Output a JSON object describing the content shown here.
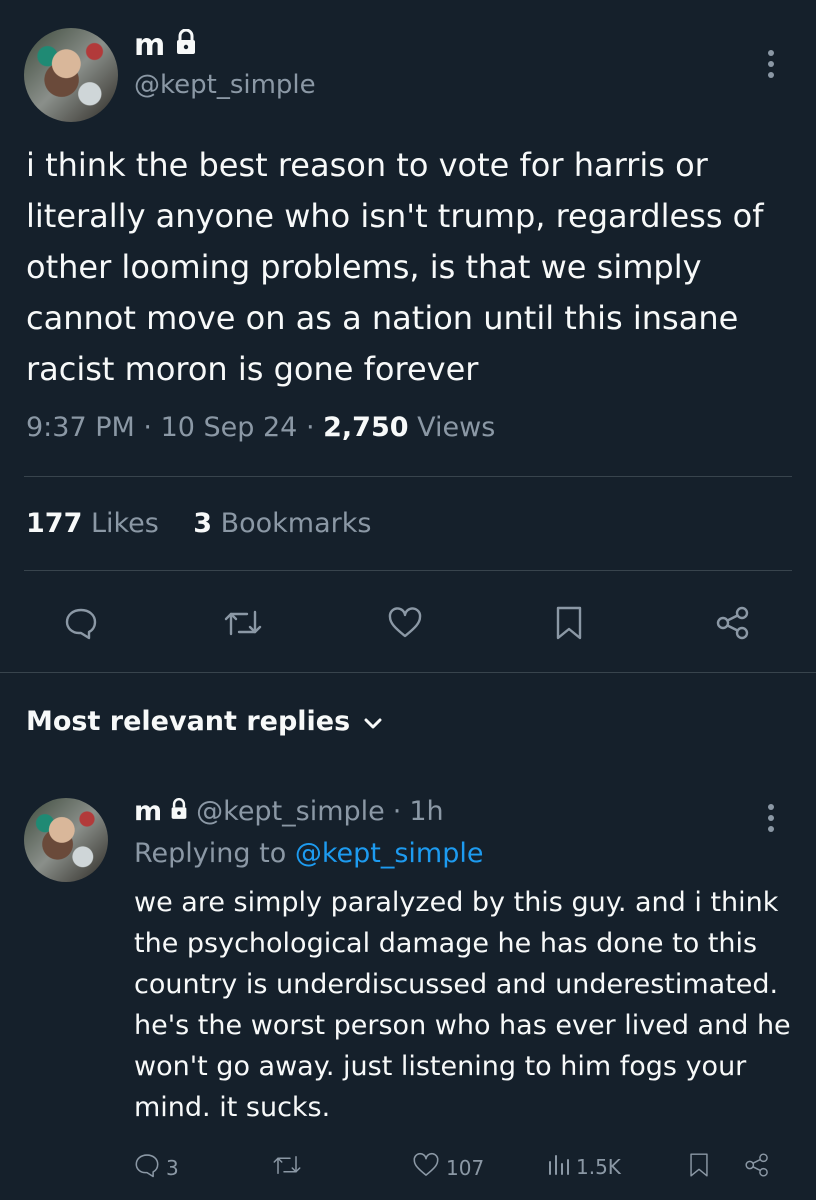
{
  "tweet": {
    "author_name": "m",
    "author_handle": "@kept_simple",
    "text": "i think the best reason to vote for harris or literally anyone who isn't trump, regardless of other looming problems, is that we simply cannot move on as a nation until this insane racist moron is gone forever",
    "time": "9:37 PM",
    "date": "10 Sep 24",
    "views_count": "2,750",
    "views_label": "Views",
    "separator": "·",
    "likes_count": "177",
    "likes_label": "Likes",
    "bookmarks_count": "3",
    "bookmarks_label": "Bookmarks"
  },
  "replies_section": {
    "header": "Most relevant replies"
  },
  "reply": {
    "author_name": "m",
    "author_handle": "@kept_simple",
    "age": "1h",
    "replying_prefix": "Replying to",
    "replying_to": "@kept_simple",
    "text": "we are simply paralyzed by this guy. and i think the psychological damage he has done to this country is underdiscussed and underestimated. he's the worst person who has ever lived and he won't go away. just listening to him fogs your mind. it sucks.",
    "reply_count": "3",
    "like_count": "107",
    "view_count": "1.5K"
  },
  "icons": {
    "lock": "lock-icon",
    "more": "more-vertical-icon",
    "reply": "reply-icon",
    "retweet": "retweet-icon",
    "like": "heart-icon",
    "bookmark": "bookmark-icon",
    "share": "share-icon",
    "chevron": "chevron-down-icon",
    "views": "analytics-icon"
  },
  "colors": {
    "background": "#15202b",
    "text": "#f7f9f9",
    "muted": "#8b98a5",
    "link": "#1d9bf0",
    "divider": "#38444d"
  }
}
